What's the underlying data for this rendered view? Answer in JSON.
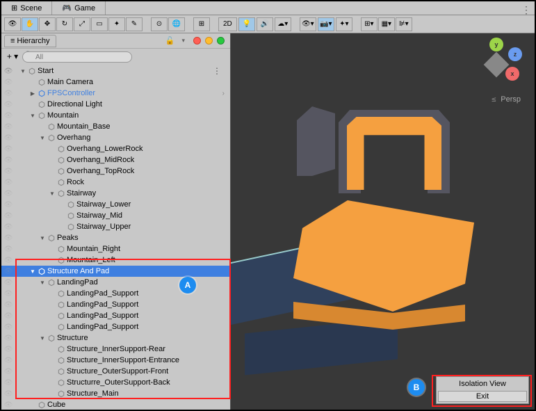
{
  "tabs": {
    "scene": "Scene",
    "game": "Game"
  },
  "toolbar": {
    "2d": "2D"
  },
  "hierarchy": {
    "title": "Hierarchy",
    "search_placeholder": "All",
    "tree": [
      {
        "id": "start",
        "label": "Start",
        "indent": 0,
        "arrow": "down",
        "menu": true
      },
      {
        "id": "main-camera",
        "label": "Main Camera",
        "indent": 1,
        "arrow": "none"
      },
      {
        "id": "fps",
        "label": "FPSController",
        "indent": 1,
        "arrow": "right",
        "prefab": true,
        "chevron": true
      },
      {
        "id": "dir-light",
        "label": "Directional Light",
        "indent": 1,
        "arrow": "none"
      },
      {
        "id": "mountain",
        "label": "Mountain",
        "indent": 1,
        "arrow": "down"
      },
      {
        "id": "mountain-base",
        "label": "Mountain_Base",
        "indent": 2,
        "arrow": "none"
      },
      {
        "id": "overhang",
        "label": "Overhang",
        "indent": 2,
        "arrow": "down"
      },
      {
        "id": "overhang-lower",
        "label": "Overhang_LowerRock",
        "indent": 3,
        "arrow": "none"
      },
      {
        "id": "overhang-mid",
        "label": "Overhang_MidRock",
        "indent": 3,
        "arrow": "none"
      },
      {
        "id": "overhang-top",
        "label": "Overhang_TopRock",
        "indent": 3,
        "arrow": "none"
      },
      {
        "id": "rock",
        "label": "Rock",
        "indent": 3,
        "arrow": "none"
      },
      {
        "id": "stairway",
        "label": "Stairway",
        "indent": 3,
        "arrow": "down"
      },
      {
        "id": "stair-lower",
        "label": "Stairway_Lower",
        "indent": 4,
        "arrow": "none"
      },
      {
        "id": "stair-mid",
        "label": "Stairway_Mid",
        "indent": 4,
        "arrow": "none"
      },
      {
        "id": "stair-upper",
        "label": "Stairway_Upper",
        "indent": 4,
        "arrow": "none"
      },
      {
        "id": "peaks",
        "label": "Peaks",
        "indent": 2,
        "arrow": "down"
      },
      {
        "id": "mtn-right",
        "label": "Mountain_Right",
        "indent": 3,
        "arrow": "none"
      },
      {
        "id": "mtn-left",
        "label": "Mountain_Left",
        "indent": 3,
        "arrow": "none"
      },
      {
        "id": "structure-pad",
        "label": "Structure And Pad",
        "indent": 1,
        "arrow": "down",
        "selected": true
      },
      {
        "id": "landing-pad",
        "label": "LandingPad",
        "indent": 2,
        "arrow": "down"
      },
      {
        "id": "lp-sup1",
        "label": "LandingPad_Support",
        "indent": 3,
        "arrow": "none"
      },
      {
        "id": "lp-sup2",
        "label": "LandingPad_Support",
        "indent": 3,
        "arrow": "none"
      },
      {
        "id": "lp-sup3",
        "label": "LandingPad_Support",
        "indent": 3,
        "arrow": "none"
      },
      {
        "id": "lp-sup4",
        "label": "LandingPad_Support",
        "indent": 3,
        "arrow": "none"
      },
      {
        "id": "structure",
        "label": "Structure",
        "indent": 2,
        "arrow": "down"
      },
      {
        "id": "s-inner-rear",
        "label": "Structure_InnerSupport-Rear",
        "indent": 3,
        "arrow": "none"
      },
      {
        "id": "s-inner-ent",
        "label": "Structure_InnerSupport-Entrance",
        "indent": 3,
        "arrow": "none"
      },
      {
        "id": "s-outer-front",
        "label": "Structure_OuterSupport-Front",
        "indent": 3,
        "arrow": "none"
      },
      {
        "id": "s-outer-back",
        "label": "Structurre_OuterSupport-Back",
        "indent": 3,
        "arrow": "none"
      },
      {
        "id": "s-main",
        "label": "Structure_Main",
        "indent": 3,
        "arrow": "none"
      },
      {
        "id": "cube",
        "label": "Cube",
        "indent": 1,
        "arrow": "none"
      }
    ]
  },
  "scene": {
    "persp": "Persp",
    "isolation_title": "Isolation View",
    "isolation_exit": "Exit",
    "axes": {
      "x": "x",
      "y": "y",
      "z": "z"
    }
  },
  "callouts": {
    "a": "A",
    "b": "B"
  }
}
